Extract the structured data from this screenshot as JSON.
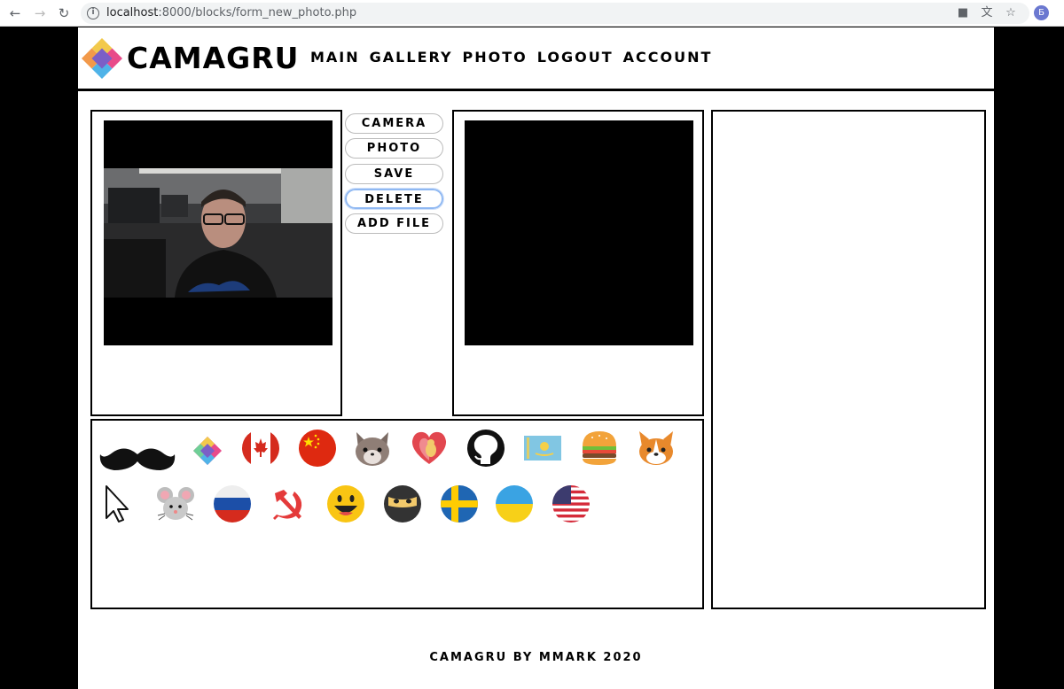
{
  "browser": {
    "url_host": "localhost",
    "url_rest": ":8000/blocks/form_new_photo.php",
    "profile_initial": "Б"
  },
  "header": {
    "brand": "CAMAGRU",
    "menu": [
      "MAIN",
      "GALLERY",
      "PHOTO",
      "LOGOUT",
      "ACCOUNT"
    ]
  },
  "controls": {
    "camera": "CAMERA",
    "photo": "PHOTO",
    "save": "SAVE",
    "delete": "DELETE",
    "add_file": "ADD FILE"
  },
  "stickers": [
    "mustache",
    "camagru-logo",
    "canada-flag",
    "china-flag",
    "cat",
    "heart-dog",
    "github",
    "kazakhstan-flag",
    "burger",
    "corgi",
    "cursor",
    "mouse",
    "russia-flag",
    "hammer-sickle",
    "smiley",
    "ninja",
    "sweden-flag",
    "ukraine-flag",
    "usa-flag"
  ],
  "footer": {
    "text": "CAMAGRU BY MMARK 2020"
  },
  "colors": {
    "accent_focus": "#8fb8f2",
    "border": "#000000"
  }
}
